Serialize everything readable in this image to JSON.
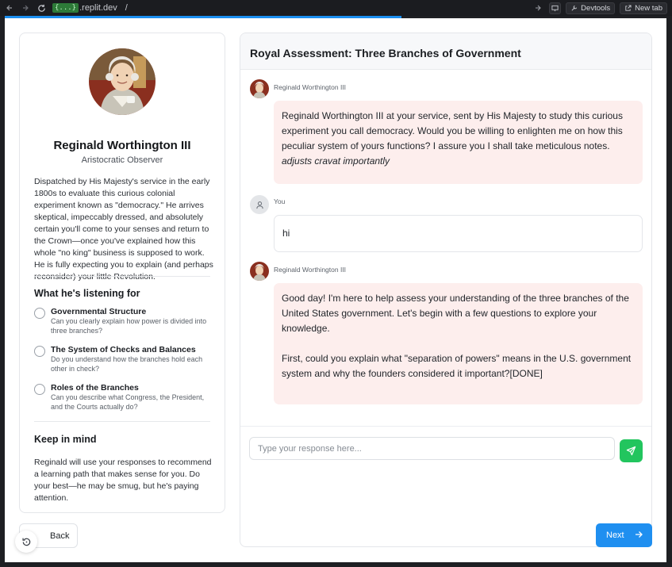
{
  "browser": {
    "url_badge": "{...}",
    "url_host": ".replit.dev",
    "url_path": "/",
    "devtools_label": "Devtools",
    "newtab_label": "New tab",
    "load_progress_percent": 60
  },
  "profile": {
    "name": "Reginald Worthington III",
    "role": "Aristocratic Observer",
    "bio": "Dispatched by His Majesty's service in the early 1800s to evaluate this curious colonial experiment known as \"democracy.\" He arrives skeptical, impeccably dressed, and absolutely certain you'll come to your senses and return to the Crown—once you've explained how this whole \"no king\" business is supposed to work. He is fully expecting you to explain (and perhaps reconsider) your little Revolution.",
    "listening_title": "What he's listening for",
    "criteria": [
      {
        "title": "Governmental Structure",
        "desc": "Can you clearly explain how power is divided into three branches?"
      },
      {
        "title": "The System of Checks and Balances",
        "desc": "Do you understand how the branches hold each other in check?"
      },
      {
        "title": "Roles of the Branches",
        "desc": "Can you describe what Congress, the President, and the Courts actually do?"
      }
    ],
    "keep_title": "Keep in mind",
    "keep_text": "Reginald will use your responses to recommend a learning path that makes sense for you. Do your best—he may be smug, but he's paying attention."
  },
  "chat": {
    "title": "Royal Assessment: Three Branches of Government",
    "messages": [
      {
        "sender": "Reginald Worthington III",
        "text": "Reginald Worthington III at your service, sent by His Majesty to study this curious experiment you call democracy. Would you be willing to enlighten me on how this peculiar system of yours functions? I assure you I shall take meticulous notes.",
        "action": "adjusts cravat importantly"
      },
      {
        "sender": "You",
        "text": "hi"
      },
      {
        "sender": "Reginald Worthington III",
        "text": "Good day! I'm here to help assess your understanding of the three branches of the United States government. Let's begin with a few questions to explore your knowledge.",
        "text2": "First, could you explain what \"separation of powers\" means in the U.S. government system and why the founders considered it important?[DONE]"
      }
    ],
    "input_placeholder": "Type your response here..."
  },
  "footer": {
    "back_label": "Back",
    "next_label": "Next"
  },
  "colors": {
    "accent_blue": "#1f8ff0",
    "send_green": "#22c55e",
    "bot_bubble": "#fdeeed"
  }
}
